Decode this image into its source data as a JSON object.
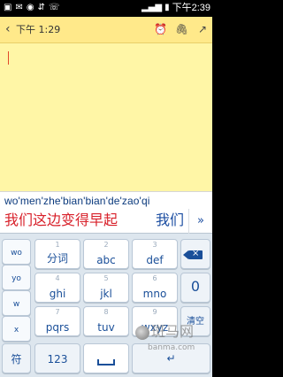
{
  "status_bar": {
    "time": "下午2:39",
    "left_icons": [
      "notification-icon",
      "mail-icon",
      "android-icon",
      "usb-icon",
      "phone-icon"
    ],
    "right_icons": [
      "signal-icon",
      "battery-icon"
    ]
  },
  "title_bar": {
    "date": "下午 1:29",
    "icons": [
      "alarm-icon",
      "attachment-icon",
      "share-icon"
    ]
  },
  "note": {
    "content": ""
  },
  "ime": {
    "pinyin": "wo'men'zhe'bian'bian'de'zao'qi",
    "candidate_main": "我们这边变得早起",
    "candidate_next": "我们",
    "more_label": "»"
  },
  "keyboard": {
    "side_keys": [
      "wo",
      "yo",
      "w",
      "x"
    ],
    "fn_keys": {
      "symbols": "符",
      "numbers": "123",
      "zero": "0",
      "clear": "清空"
    },
    "keys": [
      {
        "num": "1",
        "label": "分词"
      },
      {
        "num": "2",
        "label": "abc"
      },
      {
        "num": "3",
        "label": "def"
      },
      {
        "num": "4",
        "label": "ghi"
      },
      {
        "num": "5",
        "label": "jkl"
      },
      {
        "num": "6",
        "label": "mno"
      },
      {
        "num": "7",
        "label": "pqrs"
      },
      {
        "num": "8",
        "label": "tuv"
      },
      {
        "num": "9",
        "label": "wxyz"
      }
    ]
  },
  "watermark": {
    "text": "斑马网",
    "sub": "banma.com"
  }
}
